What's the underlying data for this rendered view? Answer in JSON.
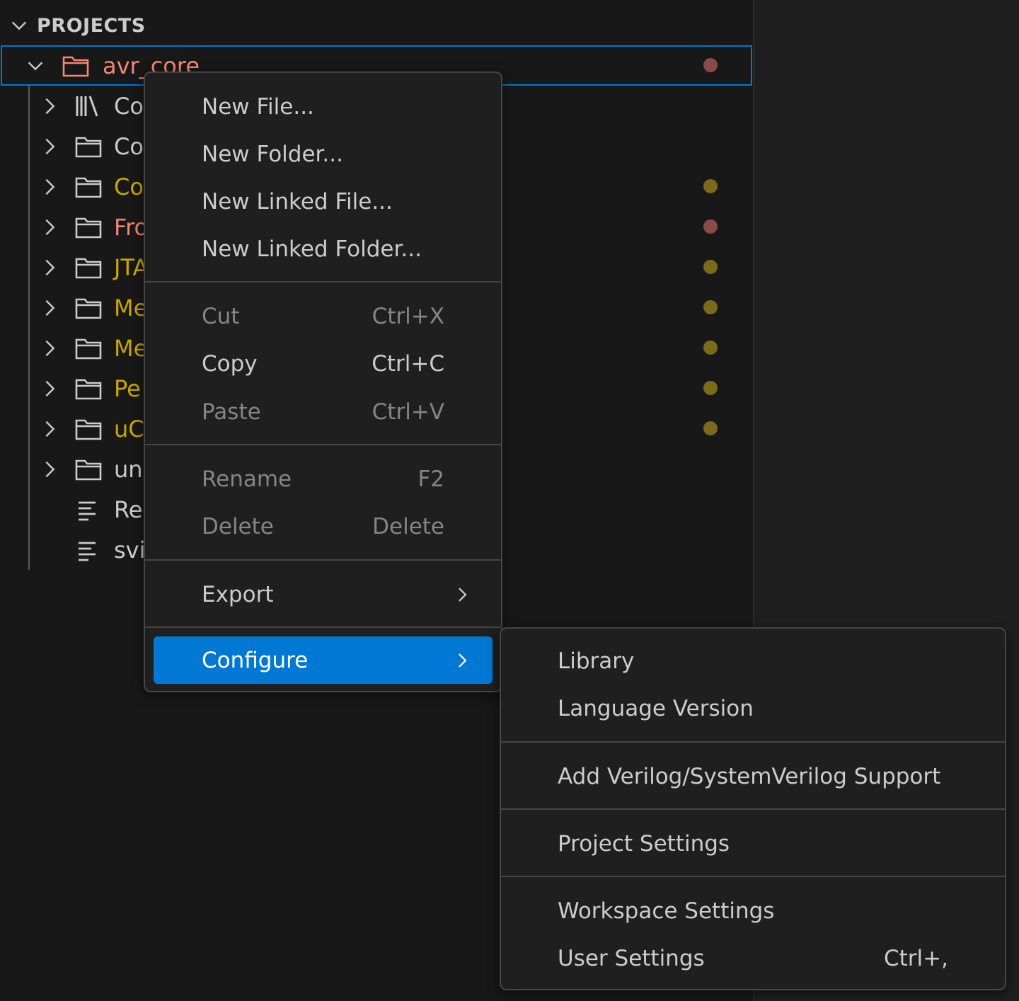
{
  "colors": {
    "accent": "#0078d4",
    "modified_red": "#f48771",
    "modified_yellow": "#cca700",
    "dot_red": "#8a4a48",
    "dot_yellow": "#7a6a1a"
  },
  "explorer": {
    "section_title": "PROJECTS",
    "root": {
      "label": "avr_core",
      "icon": "folder-icon"
    },
    "items": [
      {
        "label": "Co",
        "icon": "library-icon",
        "color": "#cccccc",
        "chevron": true,
        "dot": ""
      },
      {
        "label": "Co",
        "icon": "folder-icon",
        "color": "#cccccc",
        "chevron": true,
        "dot": ""
      },
      {
        "label": "Co",
        "icon": "folder-icon",
        "color": "#cca700",
        "chevron": true,
        "dot": "#7a6a1a"
      },
      {
        "label": "Fro",
        "icon": "folder-icon",
        "color": "#f48771",
        "chevron": true,
        "dot": "#8a4a48"
      },
      {
        "label": "JTA",
        "icon": "folder-icon",
        "color": "#cca700",
        "chevron": true,
        "dot": "#7a6a1a"
      },
      {
        "label": "Me",
        "icon": "folder-icon",
        "color": "#cca700",
        "chevron": true,
        "dot": "#7a6a1a"
      },
      {
        "label": "Me",
        "icon": "folder-icon",
        "color": "#cca700",
        "chevron": true,
        "dot": "#7a6a1a"
      },
      {
        "label": "Pe",
        "icon": "folder-icon",
        "color": "#cca700",
        "chevron": true,
        "dot": "#7a6a1a"
      },
      {
        "label": "uC",
        "icon": "folder-icon",
        "color": "#cca700",
        "chevron": true,
        "dot": "#7a6a1a"
      },
      {
        "label": "un",
        "icon": "folder-icon",
        "color": "#cccccc",
        "chevron": true,
        "dot": ""
      },
      {
        "label": "Re",
        "icon": "file-lines-icon",
        "color": "#cccccc",
        "chevron": false,
        "dot": ""
      },
      {
        "label": "svi",
        "icon": "file-lines-icon",
        "color": "#cccccc",
        "chevron": false,
        "dot": ""
      }
    ]
  },
  "context_menu": {
    "new_file": "New File...",
    "new_folder": "New Folder...",
    "new_linked_file": "New Linked File...",
    "new_linked_folder": "New Linked Folder...",
    "cut": "Cut",
    "cut_key": "Ctrl+X",
    "copy": "Copy",
    "copy_key": "Ctrl+C",
    "paste": "Paste",
    "paste_key": "Ctrl+V",
    "rename": "Rename",
    "rename_key": "F2",
    "delete": "Delete",
    "delete_key": "Delete",
    "export": "Export",
    "configure": "Configure"
  },
  "configure_submenu": {
    "library": "Library",
    "language_version": "Language Version",
    "add_verilog": "Add Verilog/SystemVerilog Support",
    "project_settings": "Project Settings",
    "workspace_settings": "Workspace Settings",
    "user_settings": "User Settings",
    "user_settings_key": "Ctrl+,"
  }
}
